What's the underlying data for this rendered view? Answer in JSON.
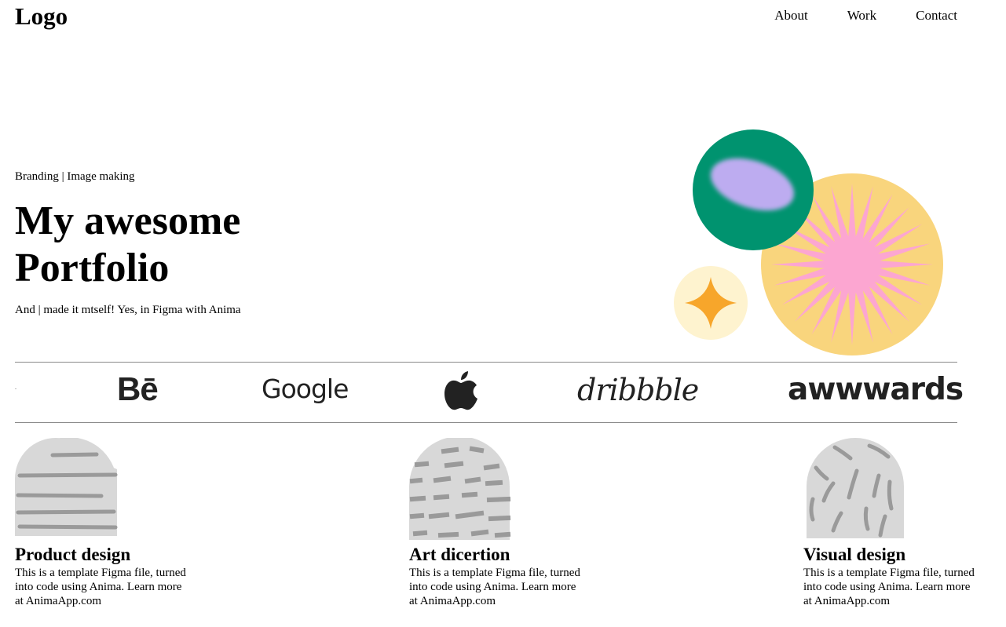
{
  "header": {
    "logo": "Logo",
    "nav": [
      "About",
      "Work",
      "Contact"
    ]
  },
  "hero": {
    "tags": "Branding | Image making",
    "title": "My awesome Portfolio",
    "subtitle": "And | made it mtself! Yes, in Figma with Anima"
  },
  "brands": {
    "behance": "Bē",
    "google": "Google",
    "apple": "apple-logo-icon",
    "dribbble": "dribbble",
    "awwwards": "awwwards"
  },
  "cards": [
    {
      "title": "Product design",
      "description": "This is a template Figma file, turned into code using Anima. Learn more at AnimaApp.com",
      "pattern": "horizontal-lines"
    },
    {
      "title": "Art dicertion",
      "description": "This is a template Figma file, turned into code using Anima. Learn more at AnimaApp.com",
      "pattern": "dashes"
    },
    {
      "title": "Visual design",
      "description": "This is a template Figma file, turned into code using Anima. Learn more at AnimaApp.com",
      "pattern": "strokes"
    }
  ],
  "colors": {
    "green_circle": "#00936F",
    "lavender_blob": "#BDACF0",
    "yellow_circle": "#F9D57D",
    "pink_burst": "#FCA6D1",
    "cream_circle": "#FEF3CF",
    "orange_star": "#F7A62B",
    "thumb_bg": "#D8D8D8",
    "thumb_mark": "#9A9A9A",
    "rule": "#8A8A8A"
  }
}
